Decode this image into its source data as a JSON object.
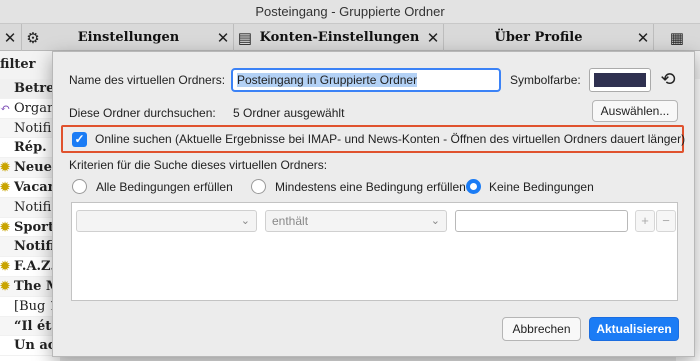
{
  "window": {
    "title": "Posteingang - Gruppierte Ordner"
  },
  "tabs": [
    {
      "icon": "gear-icon",
      "label": "Einstellungen",
      "close": "✕"
    },
    {
      "icon": "panel-icon",
      "label": "Konten-Einstellungen",
      "close": "✕"
    },
    {
      "label": "Über Profile",
      "close": "✕"
    }
  ],
  "background": {
    "filter_label": "filter",
    "column_header": "Betref",
    "rows": [
      "Organ",
      "Notifi",
      "Rép. :",
      "Neue",
      "Vacan",
      "Notifi",
      "Sport-",
      "Notifi",
      "F.A.Z.",
      "The M",
      "[Bug 1",
      "“Il éta",
      "Un ac"
    ]
  },
  "dialog": {
    "name_label": "Name des virtuellen Ordners:",
    "name_value": "Posteingang in Gruppierte Ordner",
    "color_label": "Symbolfarbe:",
    "color_value": "#2f3150",
    "search_label": "Diese Ordner durchsuchen:",
    "search_value": "5 Ordner ausgewählt",
    "choose_button": "Auswählen...",
    "online_checked": true,
    "online_label": "Online suchen (Aktuelle Ergebnisse bei IMAP- und News-Konten - Öffnen des virtuellen Ordners dauert länger)",
    "criteria_label": "Kriterien für die Suche dieses virtuellen Ordners:",
    "radio_all": "Alle Bedingungen erfüllen",
    "radio_any": "Mindestens eine Bedingung erfüllen",
    "radio_none": "Keine Bedingungen",
    "selected_radio": "Keine Bedingungen",
    "condition": {
      "field": "",
      "operator": "enthält",
      "value": ""
    },
    "add_label": "+",
    "remove_label": "−",
    "cancel_button": "Abbrechen",
    "update_button": "Aktualisieren"
  }
}
